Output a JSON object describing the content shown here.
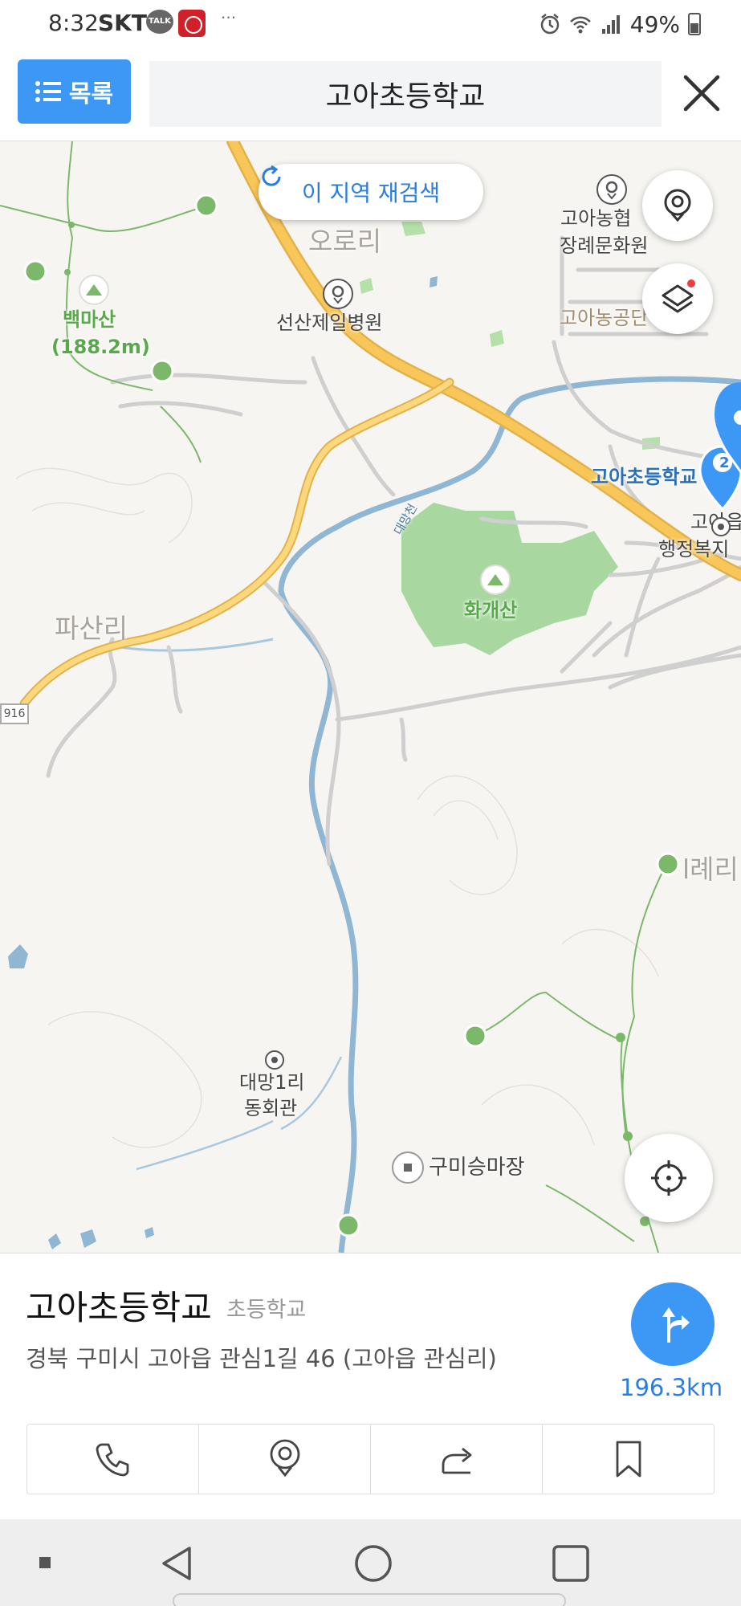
{
  "status_bar": {
    "time": "8:32",
    "carrier": "SKT",
    "talk_icon": "TALK",
    "overflow": "···",
    "battery": "49%"
  },
  "topbar": {
    "list_label": "목록",
    "search_query": "고아초등학교"
  },
  "map": {
    "research_label": "이 지역 재검색",
    "regions": [
      "오로리",
      "파산리",
      "l례리"
    ],
    "pois": {
      "hospital": "선산제일병원",
      "funeral_hall_line1": "고아농협",
      "funeral_hall_line2": "장례문화원",
      "park": "고아농공단",
      "school": "고아초등학교",
      "admin_line1": "고아읍",
      "admin_line2": "행정복지",
      "community_line1": "대망1리",
      "community_line2": "동회관",
      "racecourse": "구미승마장"
    },
    "mountains": {
      "baekma_name": "백마산",
      "baekma_height": "(188.2m)",
      "hwagae": "화개산"
    },
    "stream": "대망천",
    "road_number": "916",
    "marker_count": "2"
  },
  "place": {
    "name": "고아초등학교",
    "category": "초등학교",
    "address": "경북 구미시 고아읍 관심1길 46 (고아읍 관심리)",
    "distance": "196.3km"
  },
  "colors": {
    "accent": "#3d98f5",
    "road": "#f9c759",
    "park": "#a8d8a0",
    "water": "#8fb7d4"
  },
  "icons": [
    "list-icon",
    "close-icon",
    "refresh-icon",
    "pin-icon",
    "layers-icon",
    "locate-icon",
    "route-icon",
    "phone-icon",
    "save-pin-icon",
    "share-icon",
    "bookmark-icon"
  ]
}
